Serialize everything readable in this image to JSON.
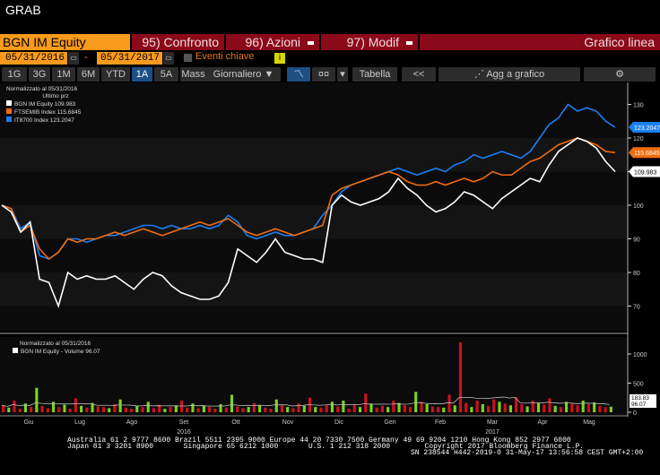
{
  "window": {
    "title": "GRAB"
  },
  "header": {
    "security": "BGN IM Equity",
    "buttons": [
      {
        "label": "95) Confronto"
      },
      {
        "label": "96) Azioni"
      },
      {
        "label": "97) Modif"
      }
    ],
    "chart_type": "Grafico linea"
  },
  "dates": {
    "start": "05/31/2016",
    "separator": "-",
    "end": "05/31/2017",
    "events_label": "Eventi chiave",
    "info": "i"
  },
  "toolbar": {
    "periods": [
      "1G",
      "3G",
      "1M",
      "6M",
      "YTD",
      "1A",
      "5A",
      "Mass"
    ],
    "selected": "1A",
    "frequency": "Giornaliero ▼",
    "table": "Tabella",
    "collapse": "<<",
    "add": "Agg a grafico",
    "settings": "⚙"
  },
  "legend": {
    "title": "Normalizzato al 05/31/2016",
    "subtitle": "Ultimo prz",
    "items": [
      {
        "name": "BGN IM Equity",
        "value": "109.983",
        "color": "#ffffff"
      },
      {
        "name": "FTSEMIB Index",
        "value": "115.6845",
        "color": "#f26c0d"
      },
      {
        "name": "IT8700 Index",
        "value": "123.2047",
        "color": "#1a7ff0"
      }
    ]
  },
  "volume_legend": {
    "title": "Normalizzato al 05/31/2016",
    "item": "BGN IM Equity - Volume 96.07",
    "last": "96.07",
    "avg": "183.83"
  },
  "chart_data": {
    "type": "line",
    "ylim": [
      63,
      136
    ],
    "yticks": [
      70,
      80,
      90,
      100,
      110,
      120,
      130
    ],
    "x_months": [
      "Giu",
      "Lug",
      "Ago",
      "Set",
      "Ott",
      "Nov",
      "Dic",
      "Gen",
      "Feb",
      "Mar",
      "Apr",
      "Mag"
    ],
    "years": [
      "2016",
      "2017"
    ],
    "series": [
      {
        "name": "BGN IM Equity",
        "color": "#ffffff",
        "values": [
          100,
          98,
          92,
          95,
          78,
          77,
          70,
          80,
          78,
          79,
          78,
          78,
          79,
          77,
          75,
          78,
          80,
          79,
          76,
          74,
          73,
          72,
          72,
          73,
          77,
          87,
          85,
          83,
          86,
          90,
          86,
          85,
          84,
          84,
          83,
          100,
          103,
          101,
          100,
          101,
          102,
          104,
          108,
          105,
          103,
          100,
          98,
          99,
          101,
          104,
          103,
          101,
          99,
          102,
          104,
          106,
          108,
          107,
          112,
          116,
          118,
          120,
          119,
          117,
          113,
          110
        ]
      },
      {
        "name": "FTSEMIB Index",
        "color": "#f26c0d",
        "values": [
          100,
          99,
          92,
          94,
          87,
          84,
          86,
          90,
          89,
          90,
          90,
          91,
          92,
          91,
          92,
          93,
          92,
          91,
          92,
          93,
          94,
          95,
          94,
          95,
          96,
          94,
          92,
          91,
          92,
          93,
          92,
          91,
          92,
          93,
          94,
          103,
          105,
          106,
          107,
          108,
          109,
          110,
          109,
          107,
          106,
          106,
          107,
          106,
          107,
          108,
          107,
          108,
          110,
          109,
          109,
          111,
          113,
          114,
          116,
          118,
          119,
          120,
          119,
          118,
          116,
          115.68
        ]
      },
      {
        "name": "IT8700 Index",
        "color": "#1a7ff0",
        "values": [
          100,
          99,
          93,
          95,
          85,
          84,
          86,
          90,
          90,
          89,
          90,
          91,
          91,
          92,
          93,
          94,
          94,
          93,
          94,
          93,
          93,
          94,
          93,
          94,
          97,
          95,
          91,
          90,
          91,
          92,
          91,
          91,
          92,
          93,
          97,
          100,
          104,
          106,
          107,
          108,
          109,
          110,
          111,
          110,
          109,
          110,
          111,
          110,
          112,
          113,
          115,
          114,
          115,
          116,
          115,
          114,
          116,
          120,
          124,
          126,
          130,
          128,
          129,
          128,
          125,
          123.2
        ]
      }
    ],
    "volume": {
      "ylim": [
        0,
        1100
      ],
      "yticks": [
        0,
        500,
        1000
      ],
      "values": [
        120,
        80,
        200,
        60,
        150,
        90,
        420,
        110,
        70,
        180,
        90,
        130,
        60,
        240,
        110,
        80,
        160,
        100,
        90,
        70,
        140,
        220,
        80,
        60,
        110,
        90,
        180,
        70,
        130,
        60,
        90,
        120,
        200,
        80,
        150,
        70,
        110,
        90,
        60,
        140,
        80,
        300,
        100,
        70,
        90,
        160,
        120,
        80,
        60,
        220,
        130,
        90,
        70,
        150,
        110,
        250,
        90,
        80,
        120,
        180,
        100,
        200,
        60,
        140,
        90,
        320,
        150,
        80,
        110,
        90,
        200,
        160,
        120,
        90,
        350,
        180,
        140,
        100,
        90,
        80,
        300,
        120,
        1200,
        160,
        90,
        200,
        140,
        110,
        220,
        180,
        150,
        120,
        260,
        140,
        100,
        200,
        160,
        130,
        240,
        110,
        90,
        180,
        150,
        120,
        200,
        140,
        170,
        110,
        90,
        96
      ]
    }
  },
  "footer": {
    "line1": "Australia 61 2 9777 8600 Brazil 5511 2395 9000 Europe 44 20 7330 7500 Germany 49 69 9204 1210 Hong Kong 852 2977 6000",
    "line2": "Japan 81 3 3201 8900       Singapore 65 6212 1000       U.S. 1 212 318 2000        Copyright 2017 Bloomberg Finance L.P.",
    "line3": "SN 238544 H442-2019-0 31-May-17 13:56:58 CEST GMT+2:00"
  }
}
